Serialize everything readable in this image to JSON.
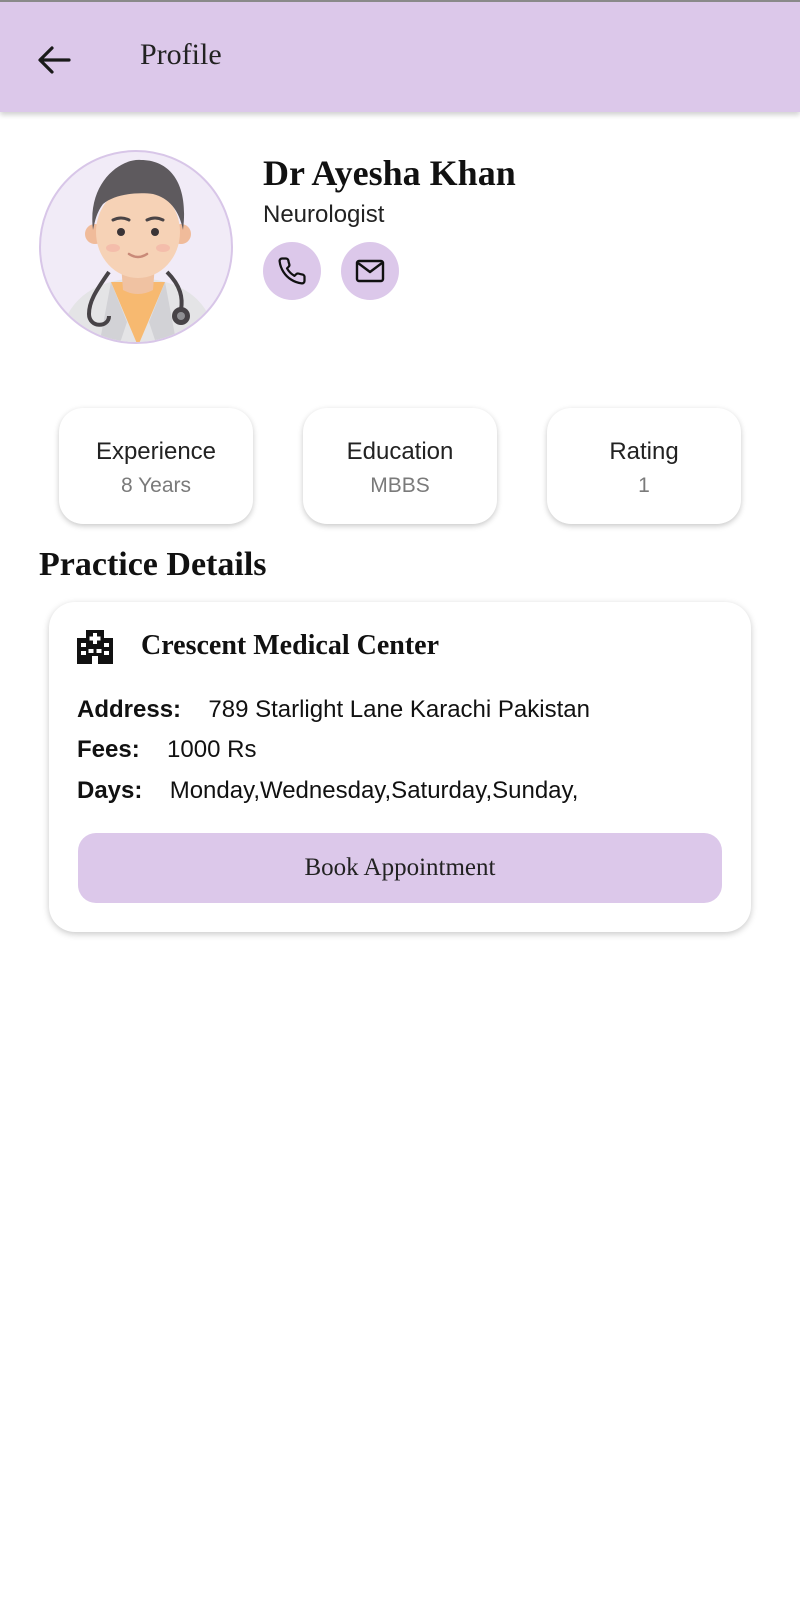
{
  "header": {
    "back_icon": "arrow-left-icon",
    "title": "Profile"
  },
  "doctor": {
    "name": "Dr Ayesha Khan",
    "specialty": "Neurologist",
    "call_icon": "phone-icon",
    "email_icon": "mail-icon"
  },
  "stats": [
    {
      "label": "Experience",
      "value": "8 Years"
    },
    {
      "label": "Education",
      "value": "MBBS"
    },
    {
      "label": "Rating",
      "value": "1"
    }
  ],
  "practice": {
    "section_title": "Practice Details",
    "clinic_icon": "hospital-icon",
    "clinic_name": "Crescent Medical Center",
    "address_label": "Address:",
    "address": "789 Starlight Lane Karachi Pakistan",
    "fees_label": "Fees:",
    "fees": "1000 Rs",
    "days_label": "Days:",
    "days": "Monday,Wednesday,Saturday,Sunday,",
    "book_label": "Book Appointment"
  },
  "colors": {
    "accent": "#dcc8ea",
    "text": "#111111",
    "muted": "#7a7a7a"
  }
}
